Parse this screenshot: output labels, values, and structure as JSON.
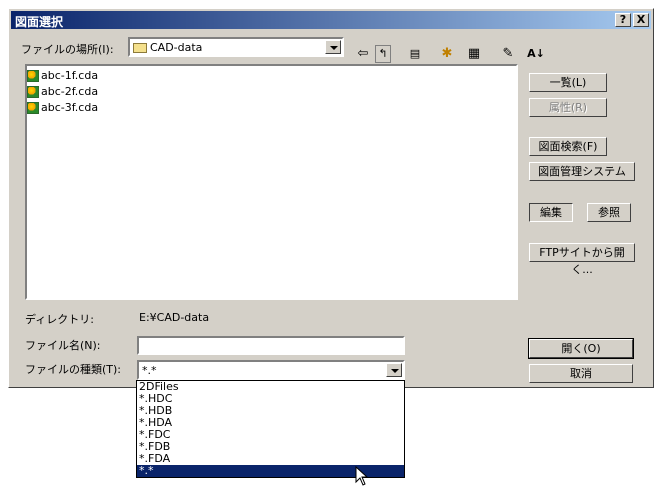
{
  "dialog": {
    "title": "図面選択",
    "help_label": "?",
    "close_label": "X"
  },
  "lookin": {
    "label": "ファイルの場所(I):",
    "value": "CAD-data"
  },
  "toolbar": {
    "back_glyph": "⇦",
    "up_glyph": "↰",
    "desktop_glyph": "▤",
    "newfolder_glyph": "✱",
    "view_glyph": "▦",
    "tools_glyph": "✎",
    "sort_glyph": "A↓"
  },
  "files": [
    {
      "name": "abc-1f.cda"
    },
    {
      "name": "abc-2f.cda"
    },
    {
      "name": "abc-3f.cda"
    }
  ],
  "buttons": {
    "list": "一覧(L)",
    "properties": "属性(R)",
    "search": "図面検索(F)",
    "manage": "図面管理システム",
    "edit": "編集",
    "browse": "参照",
    "ftp": "FTPサイトから開く...",
    "open": "開く(O)",
    "cancel": "取消"
  },
  "directory": {
    "label": "ディレクトリ:",
    "value": "E:¥CAD-data"
  },
  "filename": {
    "label": "ファイル名(N):",
    "value": ""
  },
  "filetype": {
    "label": "ファイルの種類(T):",
    "value": "*.*",
    "options": [
      "2DFiles",
      "*.HDC",
      "*.HDB",
      "*.HDA",
      "*.FDC",
      "*.FDB",
      "*.FDA",
      "*.*"
    ],
    "selected_index": 7
  }
}
